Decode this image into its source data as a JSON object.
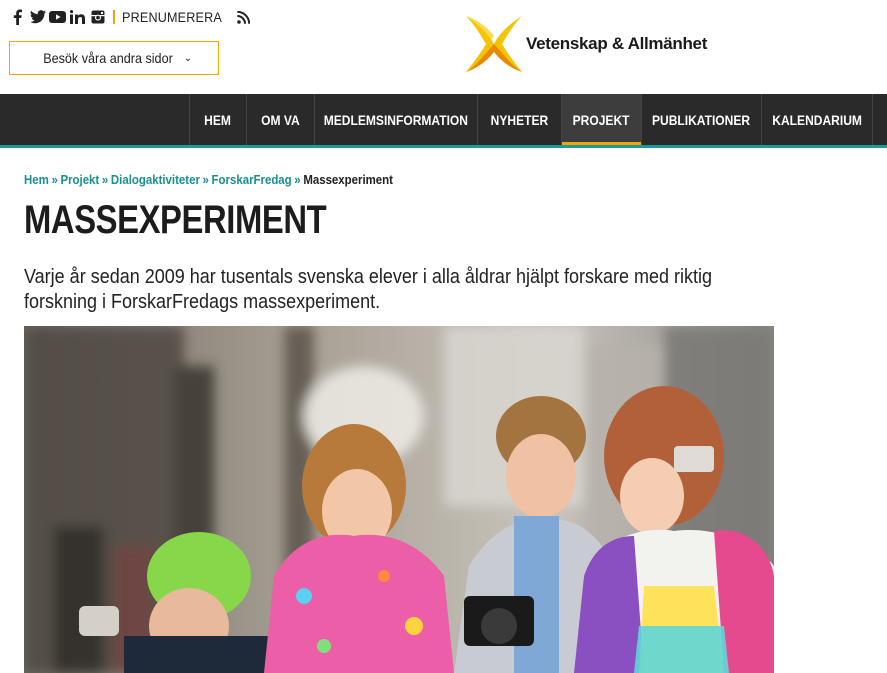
{
  "header": {
    "social_icons": [
      "facebook-icon",
      "twitter-icon",
      "youtube-icon",
      "linkedin-icon",
      "instagram-icon"
    ],
    "subscribe_label": "PRENUMERERA",
    "visit_button_label": "Besök våra andra sidor",
    "logo_text": "Vetenskap & Allmänhet"
  },
  "nav": {
    "items": [
      {
        "label": "HEM"
      },
      {
        "label": "OM VA"
      },
      {
        "label": "MEDLEMSINFORMATION"
      },
      {
        "label": "NYHETER"
      },
      {
        "label": "PROJEKT",
        "active": true
      },
      {
        "label": "PUBLIKATIONER"
      },
      {
        "label": "KALENDARIUM"
      }
    ]
  },
  "breadcrumb": {
    "items": [
      "Hem",
      "Projekt",
      "Dialogaktiviteter",
      "ForskarFredag"
    ],
    "current": "Massexperiment",
    "separator": "»"
  },
  "page": {
    "title": "MASSEXPERIMENT",
    "lead_line1": "Varje år sedan 2009 har tusentals svenska elever i alla åldrar hjälpt forskare med riktig",
    "lead_line2": "forskning i ForskarFredags massexperiment."
  },
  "colors": {
    "accent": "#f0a500",
    "teal": "#1a9a9a",
    "nav_bg": "#2a2a2a",
    "logo_yellow": "#f5c400",
    "logo_orange": "#e88a00"
  }
}
